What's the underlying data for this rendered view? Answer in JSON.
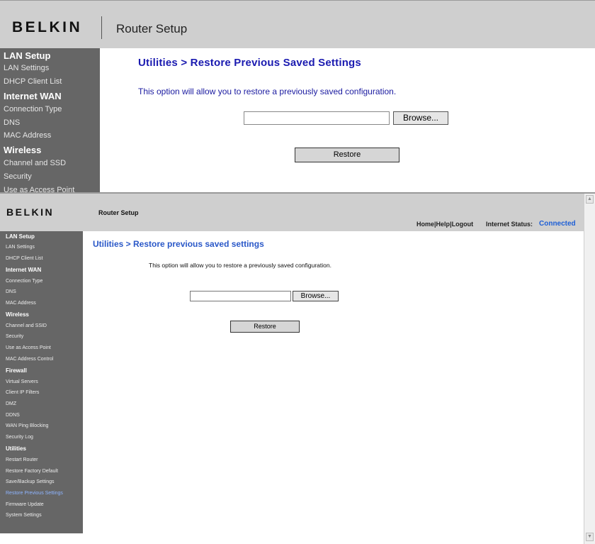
{
  "brand": "BELKIN",
  "app_title": "Router Setup",
  "top_view": {
    "page_title": "Utilities > Restore Previous Saved Settings",
    "description": "This option will allow you to restore a previously saved configuration.",
    "browse_label": "Browse...",
    "restore_label": "Restore",
    "sidebar": {
      "lan_setup": "LAN Setup",
      "lan_settings": "LAN Settings",
      "dhcp_client_list": "DHCP Client List",
      "internet_wan": "Internet WAN",
      "connection_type": "Connection Type",
      "dns": "DNS",
      "mac_address": "MAC Address",
      "wireless": "Wireless",
      "channel_ssid": "Channel and SSD",
      "security": "Security",
      "access_point": "Use as Access Point"
    }
  },
  "bottom_view": {
    "page_title": "Utilities > Restore previous saved settings",
    "description": "This option will allow you to restore a previously saved configuration.",
    "browse_label": "Browse...",
    "restore_label": "Restore",
    "nav": {
      "home": "Home",
      "help": "Help",
      "logout": "Logout",
      "sep": "|"
    },
    "internet_status_label": "Internet Status:",
    "internet_status_value": "Connected",
    "sidebar": {
      "lan_setup": "LAN Setup",
      "lan_settings": "LAN Settings",
      "dhcp_client_list": "DHCP Client List",
      "internet_wan": "Internet WAN",
      "connection_type": "Connection Type",
      "dns": "DNS",
      "mac_address": "MAC Address",
      "wireless": "Wireless",
      "channel_ssid": "Channel and SSID",
      "security": "Security",
      "access_point": "Use as Access Point",
      "mac_address_control": "MAC Address Control",
      "firewall": "Firewall",
      "virtual_servers": "Virtual Servers",
      "client_ip_filters": "Client IP Filters",
      "dmz": "DMZ",
      "ddns": "DDNS",
      "wan_ping_blocking": "WAN Ping Blocking",
      "security_log": "Security Log",
      "utilities": "Utilities",
      "restart_router": "Restart Router",
      "restore_factory_default": "Restore Factory Default",
      "save_backup_settings": "Save/Backup Settings",
      "restore_previous_settings": "Restore Previous Settings",
      "firmware_update": "Firmware Update",
      "system_settings": "System Settings"
    }
  },
  "colors": {
    "header_bg": "#cfcfcf",
    "sidebar_bg": "#666666",
    "title_blue": "#2a58c8",
    "status_blue": "#1e5fd6",
    "active_link": "#8eb4ff"
  },
  "icons": {
    "scroll_up": "scroll-up-arrow-icon",
    "scroll_down": "scroll-down-arrow-icon"
  }
}
